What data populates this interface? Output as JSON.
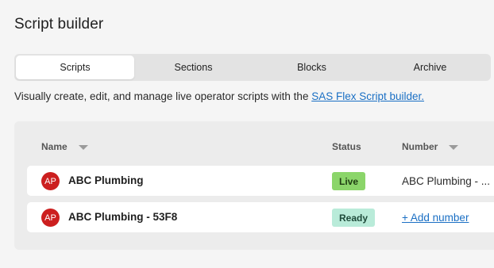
{
  "page": {
    "title": "Script builder"
  },
  "tabs": [
    {
      "label": "Scripts",
      "active": true
    },
    {
      "label": "Sections",
      "active": false
    },
    {
      "label": "Blocks",
      "active": false
    },
    {
      "label": "Archive",
      "active": false
    }
  ],
  "description": {
    "text": "Visually create, edit, and manage live operator scripts with the ",
    "link_text": "SAS Flex Script builder."
  },
  "table": {
    "headers": {
      "name": "Name",
      "status": "Status",
      "number": "Number"
    },
    "rows": [
      {
        "avatar_initials": "AP",
        "name": "ABC Plumbing",
        "status": "Live",
        "number": "ABC Plumbing - ..."
      },
      {
        "avatar_initials": "AP",
        "name": "ABC Plumbing - 53F8",
        "status": "Ready",
        "number": "+ Add number"
      }
    ]
  },
  "colors": {
    "live_badge": "#8bd56a",
    "ready_badge": "#b9ebd9",
    "avatar": "#cc1f1f",
    "link": "#1a6fc4"
  },
  "icons": {
    "sort": "chevron-down-icon"
  }
}
